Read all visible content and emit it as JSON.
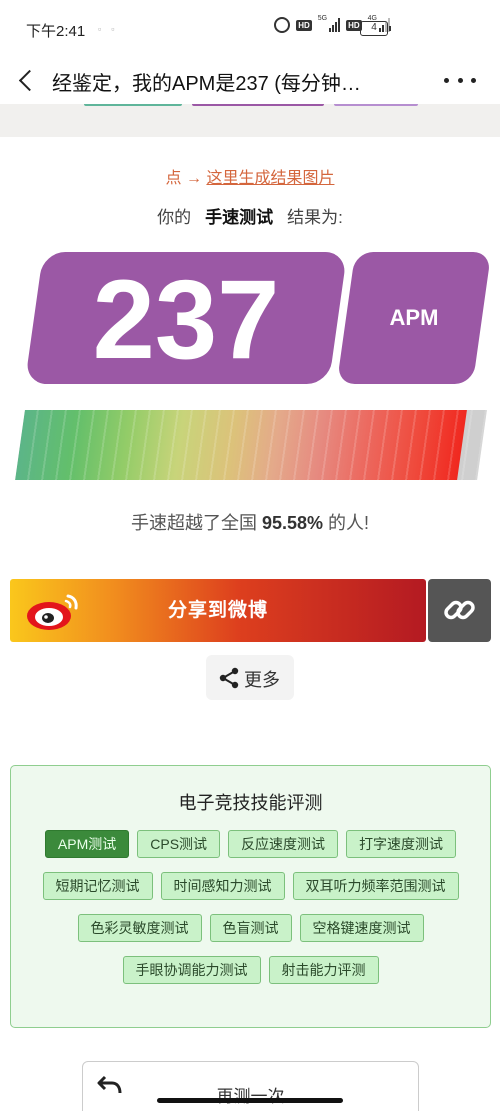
{
  "status_bar": {
    "time": "下午2:41",
    "hd_1": "HD",
    "net_1": "5G",
    "hd_2": "HD",
    "net_2": "4G",
    "battery": "4"
  },
  "nav": {
    "title": "经鉴定，我的APM是237 (每分钟…"
  },
  "generate_link": {
    "prefix": "点 → ",
    "label": "这里生成结果图片"
  },
  "result": {
    "prefix": "你的",
    "test_name": "手速测试",
    "suffix": "结果为:",
    "score": "237",
    "unit": "APM",
    "percentile": 0.9558,
    "exceed_prefix": "手速超越了全国 ",
    "exceed_value": "95.58%",
    "exceed_suffix": " 的人!"
  },
  "share": {
    "weibo_label": "分享到微博",
    "more_label": "更多"
  },
  "eval_panel": {
    "title": "电子竞技技能评测",
    "rows": [
      [
        {
          "label": "APM测试",
          "active": true
        },
        {
          "label": "CPS测试"
        },
        {
          "label": "反应速度测试"
        },
        {
          "label": "打字速度测试"
        }
      ],
      [
        {
          "label": "短期记忆测试"
        },
        {
          "label": "时间感知力测试"
        },
        {
          "label": "双耳听力频率范围测试"
        }
      ],
      [
        {
          "label": "色彩灵敏度测试"
        },
        {
          "label": "色盲测试"
        },
        {
          "label": "空格键速度测试"
        }
      ],
      [
        {
          "label": "手眼协调能力测试"
        },
        {
          "label": "射击能力评测"
        }
      ]
    ]
  },
  "retest_label": "再测一次",
  "colors": {
    "accent_purple": "#9b58a5",
    "link_orange": "#d4663d",
    "panel_green": "#eef9ee",
    "chip_active": "#3b8a3b"
  }
}
